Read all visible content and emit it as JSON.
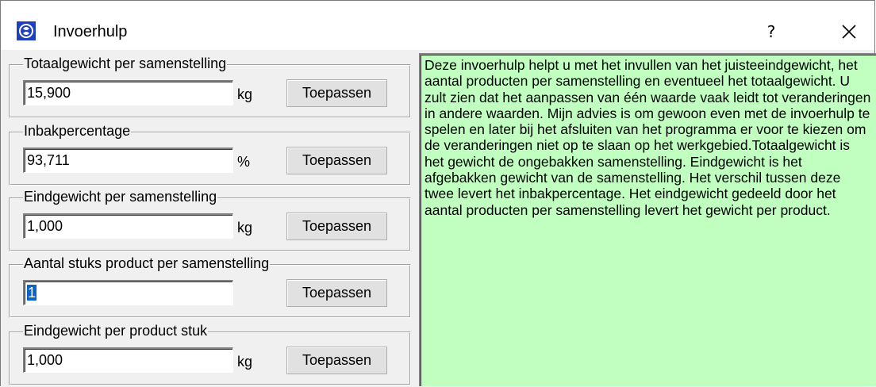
{
  "window": {
    "title": "Invoerhulp",
    "help_label": "?"
  },
  "groups": [
    {
      "legend": "Totaalgewicht per samenstelling",
      "value": "15,900",
      "unit": "kg",
      "button": "Toepassen"
    },
    {
      "legend": "Inbakpercentage",
      "value": "93,711",
      "unit": "%",
      "button": "Toepassen"
    },
    {
      "legend": "Eindgewicht per samenstelling",
      "value": "1,000",
      "unit": "kg",
      "button": "Toepassen"
    },
    {
      "legend": "Aantal stuks product per samenstelling",
      "value": "1",
      "unit": "",
      "button": "Toepassen"
    },
    {
      "legend": "Eindgewicht per product stuk",
      "value": "1,000",
      "unit": "kg",
      "button": "Toepassen"
    }
  ],
  "info_text": "Deze invoerhulp helpt u met het invullen van het juisteeindgewicht, het aantal producten per samenstelling en eventueel het totaalgewicht. U zult zien dat het aanpassen van één waarde vaak leidt tot veranderingen in andere waarden. Mijn advies is om gewoon even met de invoerhulp te spelen en later bij het afsluiten van het programma er voor te kiezen om de veranderingen niet op te slaan op het werkgebied.Totaalgewicht is het gewicht de ongebakken samenstelling. Eindgewicht is het afgebakken gewicht van de samenstelling. Het verschil tussen deze twee levert het inbakpercentage. Het eindgewicht gedeeld door het aantal producten per samenstelling levert het gewicht per product.",
  "colors": {
    "info_background": "#c0ffc0",
    "selection": "#0a64c8",
    "app_icon": "#1e3fbf"
  },
  "icons": {
    "app": "app-logo-icon",
    "close": "close-icon"
  }
}
